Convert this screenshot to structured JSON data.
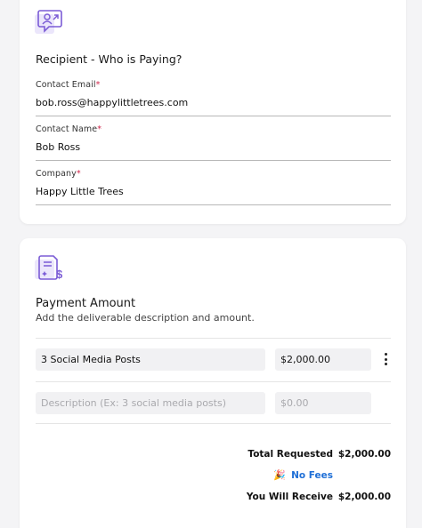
{
  "recipient": {
    "title": "Recipient - Who is Paying?",
    "icon": "user-message-icon",
    "fields": {
      "email": {
        "label": "Contact Email",
        "required_mark": "*",
        "value": "bob.ross@happylittletrees.com"
      },
      "name": {
        "label": "Contact Name",
        "required_mark": "*",
        "value": "Bob Ross"
      },
      "company": {
        "label": "Company",
        "required_mark": "*",
        "value": "Happy Little Trees"
      }
    }
  },
  "payment": {
    "title": "Payment Amount",
    "subtitle": "Add the deliverable description and amount.",
    "icon": "invoice-dollar-icon",
    "rows": [
      {
        "description": "3 Social Media Posts",
        "amount": "$2,000.00"
      }
    ],
    "new_row": {
      "description_placeholder": "Description (Ex: 3 social media posts)",
      "amount_placeholder": "$0.00"
    },
    "summary": {
      "total_label": "Total Requested",
      "total_value": "$2,000.00",
      "fees_label": "No Fees",
      "fees_icon": "party-popper-icon",
      "receive_label": "You Will Receive",
      "receive_value": "$2,000.00"
    }
  },
  "colors": {
    "accent_purple": "#7b5cd6",
    "icon_bg": "#ebe6fb",
    "required_red": "#d0264b",
    "fees_blue": "#1f6fd6"
  }
}
